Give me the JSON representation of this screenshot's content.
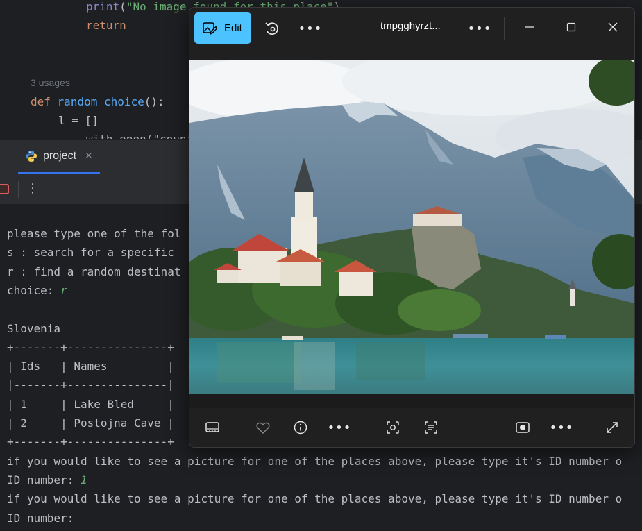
{
  "editor": {
    "lines": [
      {
        "segments": [
          {
            "t": "print",
            "c": "builtin"
          },
          {
            "t": "(",
            "c": ""
          },
          {
            "t": "\"No image found for this place\"",
            "c": "str"
          },
          {
            "t": ")",
            "c": ""
          }
        ]
      },
      {
        "segments": [
          {
            "t": "return",
            "c": "kw"
          }
        ]
      }
    ],
    "usages": "3 usages",
    "def_line": {
      "kw": "def",
      "fn": "random_choice",
      "rest": "():"
    },
    "l_line": "l = []",
    "partial_line": "with open(\"countri"
  },
  "run": {
    "tab_label": "project",
    "close_glyph": "✕",
    "more_glyph": "⋮"
  },
  "console": {
    "lines": [
      {
        "text": "please type one of the fol"
      },
      {
        "text": "s : search for a specific "
      },
      {
        "text": "r : find a random destinat"
      },
      {
        "text": "choice: ",
        "input": "r"
      },
      {
        "text": ""
      },
      {
        "text": "Slovenia"
      },
      {
        "text": "+-------+---------------+"
      },
      {
        "text": "| Ids   | Names         |"
      },
      {
        "text": "|-------+---------------|"
      },
      {
        "text": "| 1     | Lake Bled     |"
      },
      {
        "text": "| 2     | Postojna Cave |"
      },
      {
        "text": "+-------+---------------+"
      },
      {
        "text": "if you would like to see a picture for one of the places above, please type it's ID number o"
      },
      {
        "text": "ID number: ",
        "input": "1"
      },
      {
        "text": "if you would like to see a picture for one of the places above, please type it's ID number o"
      },
      {
        "text": "ID number: "
      }
    ]
  },
  "viewer": {
    "edit_label": "Edit",
    "file_title": "tmpgghyrzt...",
    "more_glyph": "•••",
    "colors": {
      "accent": "#4cc2ff",
      "window_bg": "#202020"
    }
  }
}
